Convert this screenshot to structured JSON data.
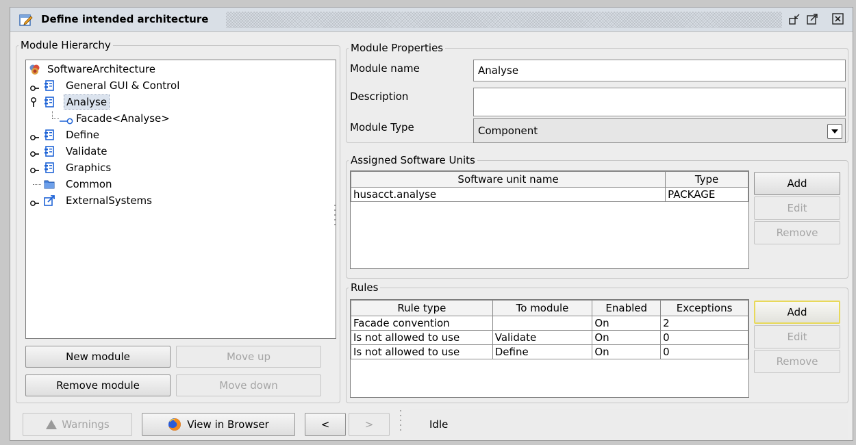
{
  "window": {
    "title": "Define intended architecture",
    "icons": [
      "edit-window-icon",
      "minimize-icon",
      "maximize-icon",
      "close-icon"
    ]
  },
  "hierarchy": {
    "legend": "Module Hierarchy",
    "root": "SoftwareArchitecture",
    "items": [
      {
        "label": "General GUI & Control",
        "icon": "component-icon",
        "expandable": true
      },
      {
        "label": "Analyse",
        "icon": "component-icon",
        "expandable": true,
        "expanded": true,
        "selected": true
      },
      {
        "label": "Facade<Analyse>",
        "icon": "facade-icon",
        "child": true
      },
      {
        "label": "Define",
        "icon": "component-icon",
        "expandable": true
      },
      {
        "label": "Validate",
        "icon": "component-icon",
        "expandable": true
      },
      {
        "label": "Graphics",
        "icon": "component-icon",
        "expandable": true
      },
      {
        "label": "Common",
        "icon": "folder-icon",
        "expandable": false
      },
      {
        "label": "ExternalSystems",
        "icon": "external-link-icon",
        "expandable": true
      }
    ],
    "buttons": {
      "new_module": "New module",
      "move_up": "Move up",
      "remove_module": "Remove module",
      "move_down": "Move down"
    }
  },
  "properties": {
    "legend": "Module Properties",
    "name_label": "Module name",
    "name_value": "Analyse",
    "description_label": "Description",
    "description_value": "",
    "type_label": "Module Type",
    "type_value": "Component"
  },
  "software_units": {
    "legend": "Assigned Software Units",
    "columns": [
      "Software unit name",
      "Type"
    ],
    "rows": [
      [
        "husacct.analyse",
        "PACKAGE"
      ]
    ],
    "buttons": {
      "add": "Add",
      "edit": "Edit",
      "remove": "Remove"
    }
  },
  "rules": {
    "legend": "Rules",
    "columns": [
      "Rule type",
      "To module",
      "Enabled",
      "Exceptions"
    ],
    "rows": [
      [
        "Facade convention",
        "",
        "On",
        "2"
      ],
      [
        "Is not allowed to use",
        "Validate",
        "On",
        "0"
      ],
      [
        "Is not allowed to use",
        "Define",
        "On",
        "0"
      ]
    ],
    "buttons": {
      "add": "Add",
      "edit": "Edit",
      "remove": "Remove"
    }
  },
  "bottom_bar": {
    "warnings": "Warnings",
    "view_in_browser": "View in Browser",
    "prev": "<",
    "next": ">",
    "status": "Idle"
  },
  "colors": {
    "titlebar": "#d9dfe6",
    "selection": "#dbe3ee",
    "focus_border": "#e8d95a",
    "component_icon": "#1e63d6"
  }
}
